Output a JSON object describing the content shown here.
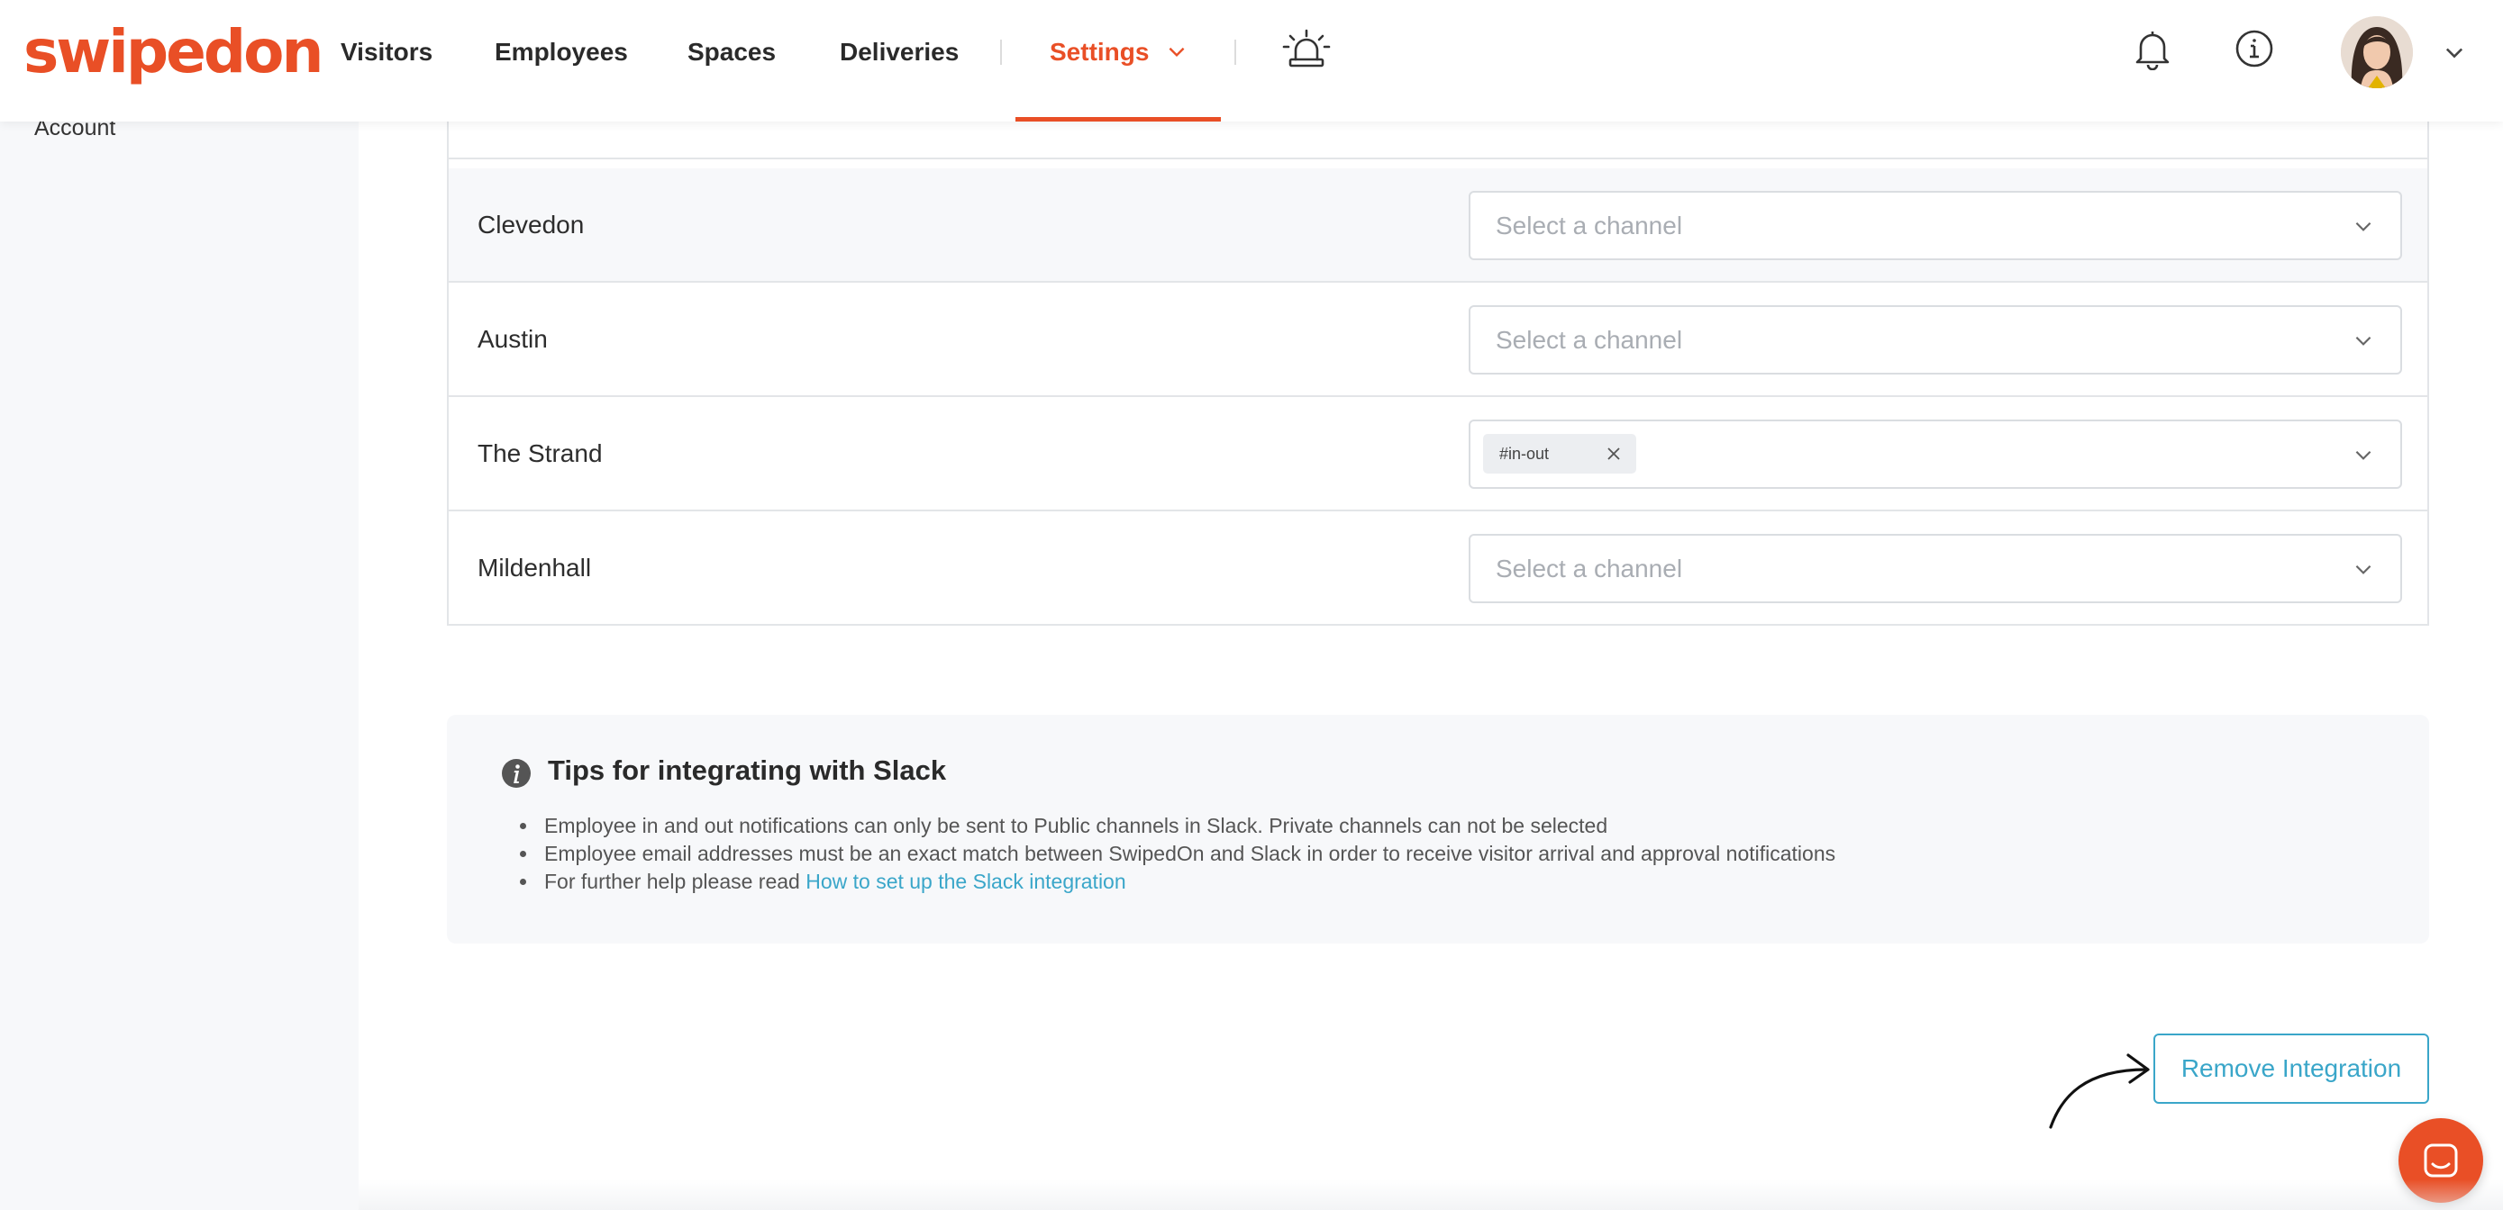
{
  "brand": {
    "logo_text": "swipedon",
    "accent": "#e94f26",
    "link": "#3aa6c9"
  },
  "nav": {
    "items": [
      "Visitors",
      "Employees",
      "Spaces",
      "Deliveries"
    ],
    "settings_label": "Settings",
    "icons": [
      "evacuation-alarm-icon",
      "bell-icon",
      "info-icon",
      "avatar",
      "chevron-down-icon"
    ]
  },
  "sidebar": {
    "account_label": "Account"
  },
  "channels": {
    "rows": [
      {
        "location": "Clevedon",
        "placeholder": "Select a channel",
        "chips": []
      },
      {
        "location": "Austin",
        "placeholder": "Select a channel",
        "chips": []
      },
      {
        "location": "The Strand",
        "placeholder": "",
        "chips": [
          "#in-out"
        ]
      },
      {
        "location": "Mildenhall",
        "placeholder": "Select a channel",
        "chips": []
      }
    ]
  },
  "tips": {
    "title": "Tips for integrating with Slack",
    "items": [
      "Employee in and out notifications can only be sent to Public channels in Slack. Private channels can not be selected",
      "Employee email addresses must be an exact match between SwipedOn and Slack in order to receive visitor arrival and approval notifications"
    ],
    "help_prefix": "For further help please read ",
    "help_link": "How to set up the Slack integration"
  },
  "actions": {
    "remove_label": "Remove Integration"
  }
}
